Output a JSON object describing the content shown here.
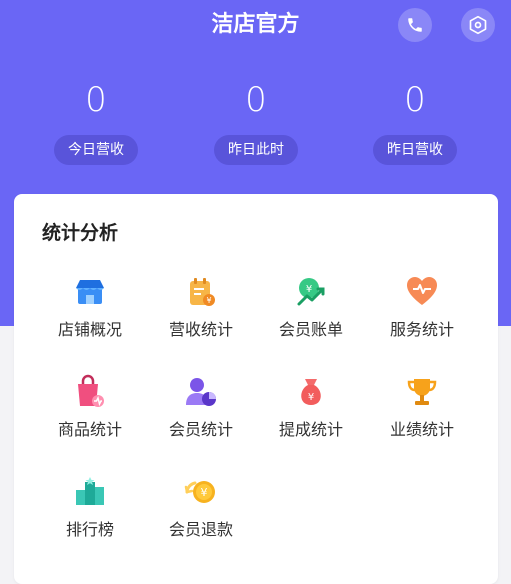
{
  "header": {
    "title": "洁店官方",
    "phone_icon": "phone-icon",
    "settings_icon": "settings-hex-icon"
  },
  "stats": [
    {
      "value": "0",
      "label": "今日营收"
    },
    {
      "value": "0",
      "label": "昨日此时"
    },
    {
      "value": "0",
      "label": "昨日营收"
    }
  ],
  "analysis": {
    "title": "统计分析",
    "items": [
      {
        "label": "店铺概况",
        "icon": "store-icon"
      },
      {
        "label": "营收统计",
        "icon": "revenue-calendar-icon"
      },
      {
        "label": "会员账单",
        "icon": "member-bill-icon"
      },
      {
        "label": "服务统计",
        "icon": "service-heart-icon"
      },
      {
        "label": "商品统计",
        "icon": "shopping-bag-icon"
      },
      {
        "label": "会员统计",
        "icon": "member-chart-icon"
      },
      {
        "label": "提成统计",
        "icon": "money-bag-icon"
      },
      {
        "label": "业绩统计",
        "icon": "trophy-icon"
      },
      {
        "label": "排行榜",
        "icon": "ranking-icon"
      },
      {
        "label": "会员退款",
        "icon": "refund-coin-icon"
      }
    ]
  },
  "colors": {
    "primary": "#6a66f5",
    "background": "#f3f3f6"
  }
}
